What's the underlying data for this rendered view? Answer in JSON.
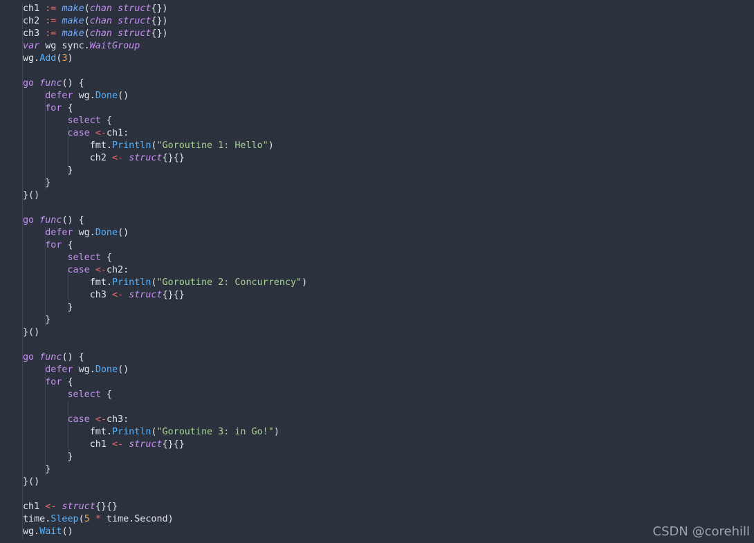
{
  "code_lines": [
    [
      [
        "ch1 ",
        "pl"
      ],
      [
        ":=",
        "op"
      ],
      [
        " ",
        "pl"
      ],
      [
        "make",
        "fn"
      ],
      [
        "(",
        "pl"
      ],
      [
        "chan struct",
        "ty"
      ],
      [
        "{})",
        "pl"
      ]
    ],
    [
      [
        "ch2 ",
        "pl"
      ],
      [
        ":=",
        "op"
      ],
      [
        " ",
        "pl"
      ],
      [
        "make",
        "fn"
      ],
      [
        "(",
        "pl"
      ],
      [
        "chan struct",
        "ty"
      ],
      [
        "{})",
        "pl"
      ]
    ],
    [
      [
        "ch3 ",
        "pl"
      ],
      [
        ":=",
        "op"
      ],
      [
        " ",
        "pl"
      ],
      [
        "make",
        "fn"
      ],
      [
        "(",
        "pl"
      ],
      [
        "chan struct",
        "ty"
      ],
      [
        "{})",
        "pl"
      ]
    ],
    [
      [
        "var",
        "ty"
      ],
      [
        " wg sync.",
        "pl"
      ],
      [
        "WaitGroup",
        "ty"
      ]
    ],
    [
      [
        "wg.",
        "pl"
      ],
      [
        "Add",
        "me"
      ],
      [
        "(",
        "pl"
      ],
      [
        "3",
        "nu"
      ],
      [
        ")",
        "pl"
      ]
    ],
    [],
    [
      [
        "go",
        "kw"
      ],
      [
        " ",
        "pl"
      ],
      [
        "func",
        "ty"
      ],
      [
        "() {",
        "pl"
      ]
    ],
    [
      [
        "    ",
        "pl"
      ],
      [
        "defer",
        "kw"
      ],
      [
        " wg.",
        "pl"
      ],
      [
        "Done",
        "me"
      ],
      [
        "()",
        "pl"
      ]
    ],
    [
      [
        "    ",
        "pl"
      ],
      [
        "for",
        "kw"
      ],
      [
        " {",
        "pl"
      ]
    ],
    [
      [
        "        ",
        "pl"
      ],
      [
        "select",
        "kw"
      ],
      [
        " {",
        "pl"
      ]
    ],
    [
      [
        "        ",
        "pl"
      ],
      [
        "case",
        "kw"
      ],
      [
        " ",
        "pl"
      ],
      [
        "<-",
        "op"
      ],
      [
        "ch1:",
        "pl"
      ]
    ],
    [
      [
        "            fmt.",
        "pl"
      ],
      [
        "Println",
        "me"
      ],
      [
        "(",
        "pl"
      ],
      [
        "\"Goroutine 1: Hello\"",
        "st"
      ],
      [
        ")",
        "pl"
      ]
    ],
    [
      [
        "            ch2 ",
        "pl"
      ],
      [
        "<-",
        "op"
      ],
      [
        " ",
        "pl"
      ],
      [
        "struct",
        "ty"
      ],
      [
        "{}{}",
        "pl"
      ]
    ],
    [
      [
        "        }",
        "pl"
      ]
    ],
    [
      [
        "    }",
        "pl"
      ]
    ],
    [
      [
        "}()",
        "pl"
      ]
    ],
    [],
    [
      [
        "go",
        "kw"
      ],
      [
        " ",
        "pl"
      ],
      [
        "func",
        "ty"
      ],
      [
        "() {",
        "pl"
      ]
    ],
    [
      [
        "    ",
        "pl"
      ],
      [
        "defer",
        "kw"
      ],
      [
        " wg.",
        "pl"
      ],
      [
        "Done",
        "me"
      ],
      [
        "()",
        "pl"
      ]
    ],
    [
      [
        "    ",
        "pl"
      ],
      [
        "for",
        "kw"
      ],
      [
        " {",
        "pl"
      ]
    ],
    [
      [
        "        ",
        "pl"
      ],
      [
        "select",
        "kw"
      ],
      [
        " {",
        "pl"
      ]
    ],
    [
      [
        "        ",
        "pl"
      ],
      [
        "case",
        "kw"
      ],
      [
        " ",
        "pl"
      ],
      [
        "<-",
        "op"
      ],
      [
        "ch2:",
        "pl"
      ]
    ],
    [
      [
        "            fmt.",
        "pl"
      ],
      [
        "Println",
        "me"
      ],
      [
        "(",
        "pl"
      ],
      [
        "\"Goroutine 2: Concurrency\"",
        "st"
      ],
      [
        ")",
        "pl"
      ]
    ],
    [
      [
        "            ch3 ",
        "pl"
      ],
      [
        "<-",
        "op"
      ],
      [
        " ",
        "pl"
      ],
      [
        "struct",
        "ty"
      ],
      [
        "{}{}",
        "pl"
      ]
    ],
    [
      [
        "        }",
        "pl"
      ]
    ],
    [
      [
        "    }",
        "pl"
      ]
    ],
    [
      [
        "}()",
        "pl"
      ]
    ],
    [],
    [
      [
        "go",
        "kw"
      ],
      [
        " ",
        "pl"
      ],
      [
        "func",
        "ty"
      ],
      [
        "() {",
        "pl"
      ]
    ],
    [
      [
        "    ",
        "pl"
      ],
      [
        "defer",
        "kw"
      ],
      [
        " wg.",
        "pl"
      ],
      [
        "Done",
        "me"
      ],
      [
        "()",
        "pl"
      ]
    ],
    [
      [
        "    ",
        "pl"
      ],
      [
        "for",
        "kw"
      ],
      [
        " {",
        "pl"
      ]
    ],
    [
      [
        "        ",
        "pl"
      ],
      [
        "select",
        "kw"
      ],
      [
        " {",
        "pl"
      ]
    ],
    [],
    [
      [
        "        ",
        "pl"
      ],
      [
        "case",
        "kw"
      ],
      [
        " ",
        "pl"
      ],
      [
        "<-",
        "op"
      ],
      [
        "ch3:",
        "pl"
      ]
    ],
    [
      [
        "            fmt.",
        "pl"
      ],
      [
        "Println",
        "me"
      ],
      [
        "(",
        "pl"
      ],
      [
        "\"Goroutine 3: in Go!\"",
        "st"
      ],
      [
        ")",
        "pl"
      ]
    ],
    [
      [
        "            ch1 ",
        "pl"
      ],
      [
        "<-",
        "op"
      ],
      [
        " ",
        "pl"
      ],
      [
        "struct",
        "ty"
      ],
      [
        "{}{}",
        "pl"
      ]
    ],
    [
      [
        "        }",
        "pl"
      ]
    ],
    [
      [
        "    }",
        "pl"
      ]
    ],
    [
      [
        "}()",
        "pl"
      ]
    ],
    [],
    [
      [
        "ch1 ",
        "pl"
      ],
      [
        "<-",
        "op"
      ],
      [
        " ",
        "pl"
      ],
      [
        "struct",
        "ty"
      ],
      [
        "{}{}",
        "pl"
      ]
    ],
    [
      [
        "time.",
        "pl"
      ],
      [
        "Sleep",
        "me"
      ],
      [
        "(",
        "pl"
      ],
      [
        "5",
        "nu"
      ],
      [
        " ",
        "pl"
      ],
      [
        "*",
        "op"
      ],
      [
        " time.Second)",
        "pl"
      ]
    ],
    [
      [
        "wg.",
        "pl"
      ],
      [
        "Wait",
        "me"
      ],
      [
        "()",
        "pl"
      ]
    ]
  ],
  "watermark": "CSDN @corehill",
  "colors": {
    "background": "#2b323d",
    "plain": "#e3e6eb",
    "operator": "#ef6a6a",
    "function_call": "#6fa8ff",
    "keyword": "#c78ef5",
    "method": "#56b2ff",
    "number": "#f0a45a",
    "string": "#a9d38f"
  }
}
